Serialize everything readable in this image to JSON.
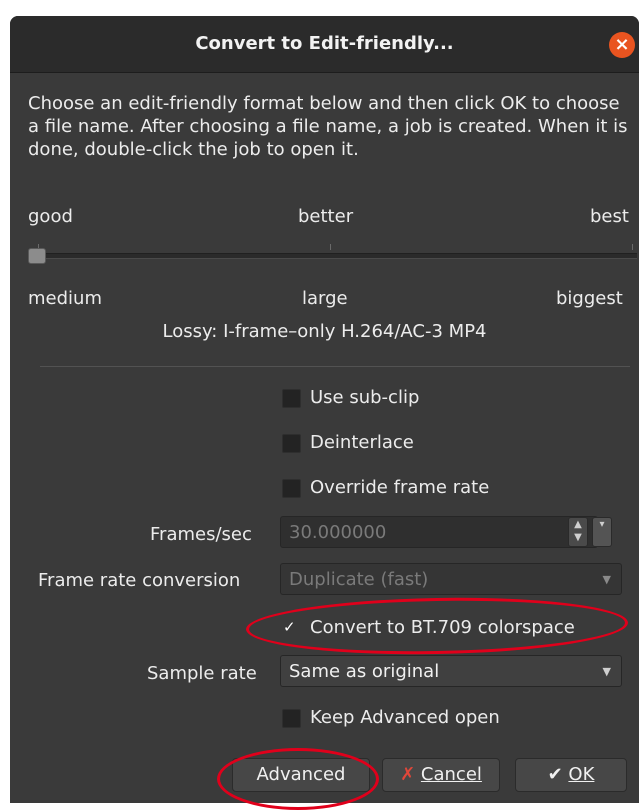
{
  "dialog": {
    "title": "Convert to Edit-friendly...",
    "close_icon": "×",
    "description": "Choose an edit-friendly format below and then click OK to choose a file name. After choosing a file name, a job is created. When it is done, double-click the job to open it."
  },
  "quality_slider": {
    "top_labels": [
      "good",
      "better",
      "best"
    ],
    "bottom_labels": [
      "medium",
      "large",
      "biggest"
    ],
    "selected_index": 0,
    "format_description": "Lossy: I-frame–only H.264/AC-3 MP4"
  },
  "options": {
    "use_subclip": {
      "label": "Use sub-clip",
      "checked": false
    },
    "deinterlace": {
      "label": "Deinterlace",
      "checked": false
    },
    "override_frame_rate": {
      "label": "Override frame rate",
      "checked": false
    },
    "frames_per_sec": {
      "label": "Frames/sec",
      "value": "30.000000"
    },
    "frame_rate_conversion": {
      "label": "Frame rate conversion",
      "value": "Duplicate (fast)"
    },
    "convert_bt709": {
      "label": "Convert to BT.709 colorspace",
      "checked": true,
      "check_glyph": "✓"
    },
    "sample_rate": {
      "label": "Sample rate",
      "value": "Same as original"
    },
    "keep_advanced_open": {
      "label": "Keep Advanced open",
      "checked": false
    }
  },
  "buttons": {
    "advanced": "Advanced",
    "cancel_icon": "✗",
    "cancel": "Cancel",
    "ok_icon": "✔",
    "ok": "OK"
  },
  "colors": {
    "dialog_bg": "#3a3a3a",
    "titlebar_bg": "#2b2b2b",
    "close_button": "#e95420",
    "annotation_red": "#e0001b"
  }
}
